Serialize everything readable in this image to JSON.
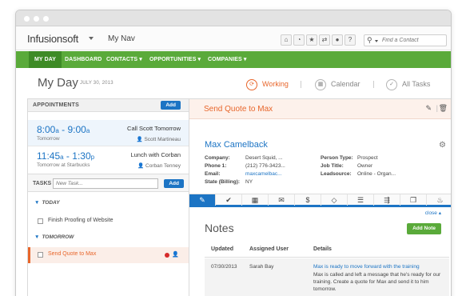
{
  "header": {
    "brand": "Infusionsoft",
    "nav_name": "My Nav",
    "search_placeholder": "Find a Contact",
    "icons": [
      "home-icon",
      "clock-icon",
      "star-icon",
      "shuffle-icon",
      "user-icon",
      "help-icon"
    ]
  },
  "main_nav": [
    "MY DAY",
    "DASHBOARD",
    "CONTACTS ▾",
    "OPPORTUNITIES ▾",
    "COMPANIES ▾"
  ],
  "day": {
    "title": "My Day",
    "date": "JULY 30, 2013",
    "views": [
      "Working",
      "Calendar",
      "All Tasks"
    ]
  },
  "appointments": {
    "heading": "APPOINTMENTS",
    "add_label": "Add",
    "items": [
      {
        "start": "8:00",
        "start_suffix": "a",
        "end": "9:00",
        "end_suffix": "a",
        "location": "Tomorrow",
        "title": "Call Scott Tomorrow",
        "person": "Scott Martineau"
      },
      {
        "start": "11:45",
        "start_suffix": "a",
        "end": "1:30",
        "end_suffix": "p",
        "location": "Tomorrow at Starbucks",
        "title": "Lunch with Corban",
        "person": "Corban Tenney"
      }
    ]
  },
  "tasks": {
    "heading": "TASKS",
    "input_placeholder": "New Task...",
    "add_label": "Add",
    "groups": [
      {
        "label": "TODAY",
        "items": [
          "Finish Proofing of Website"
        ]
      },
      {
        "label": "TOMORROW",
        "items": [
          "Send Quote to Max"
        ]
      }
    ]
  },
  "task_detail": {
    "title": "Send Quote to Max",
    "contact": {
      "name": "Max Camelback",
      "company_label": "Company:",
      "company": "Desert Squid, ...",
      "phone_label": "Phone 1:",
      "phone": "(212) 776-3423...",
      "email_label": "Email:",
      "email": "maxcamelbac...",
      "state_label": "State (Billing):",
      "state": "NY",
      "person_type_label": "Person Type:",
      "person_type": "Prospect",
      "job_title_label": "Job Title:",
      "job_title": "Owner",
      "leadsource_label": "Leadsource:",
      "leadsource": "Online - Organ..."
    },
    "tab_icons": [
      "edit-icon",
      "check-icon",
      "calendar-icon",
      "mail-icon",
      "dollar-icon",
      "tag-icon",
      "list-icon",
      "sequence-icon",
      "copy-icon",
      "fire-icon"
    ],
    "close_label": "close ▴"
  },
  "notes": {
    "title": "Notes",
    "add_label": "Add Note",
    "columns": [
      "Updated",
      "Assigned User",
      "Details"
    ],
    "rows": [
      {
        "updated": "07/30/2013",
        "user": "Sarah Bay",
        "headline": "Max is ready to move forward with the training",
        "body": "Max is called and left a message that he's ready for our training. Create a quote for Max and send it to him tomorrow."
      }
    ]
  },
  "colors": {
    "accent_green": "#5aaa3a",
    "accent_blue": "#1c74c4",
    "accent_orange": "#e8662b"
  }
}
